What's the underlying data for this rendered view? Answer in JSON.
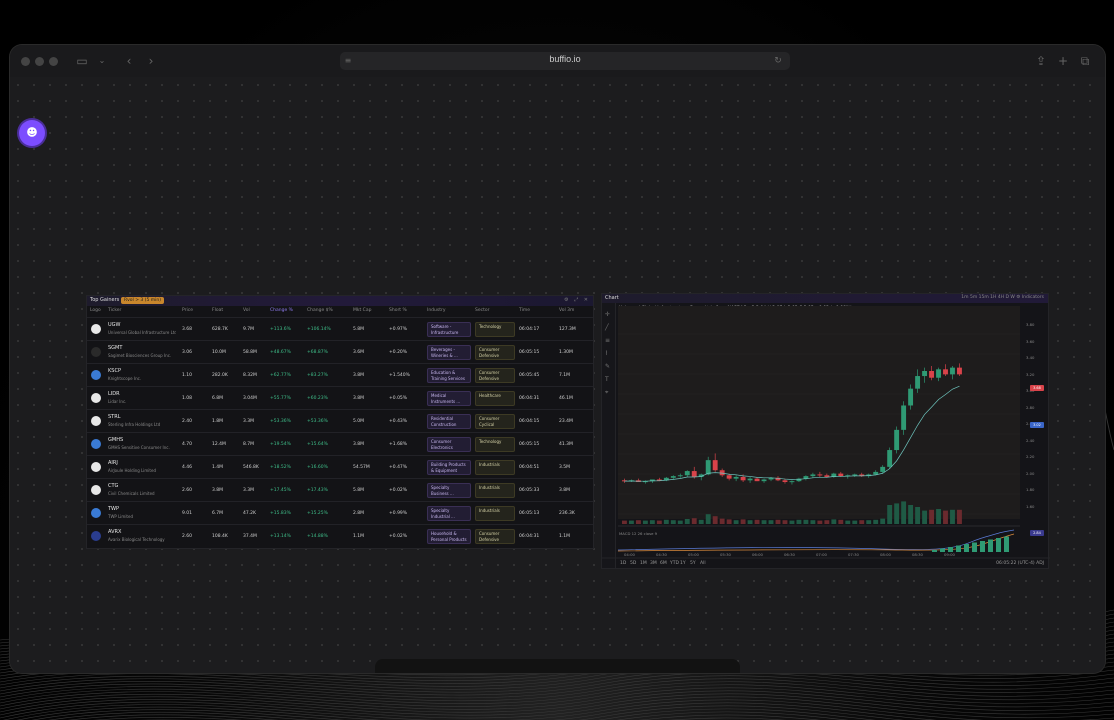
{
  "browser": {
    "url": "buffio.io",
    "nav": {
      "sidebar": "sidebar-icon",
      "back": "chevron-left-icon",
      "forward": "chevron-right-icon",
      "reload": "reload-icon",
      "share": "share-icon",
      "new_tab": "plus-icon",
      "tabs": "tabs-icon"
    }
  },
  "screener": {
    "title": "Top Gainers",
    "badge": "Rvol > 3 (5 min)",
    "columns": [
      "Logo",
      "Ticker",
      "Price",
      "Float",
      "Vol",
      "Change %",
      "Change $%",
      "Mkt Cap",
      "Short %",
      "Industry",
      "Sector",
      "Time",
      "Vol 3m"
    ],
    "rows": [
      {
        "sym": "UGW",
        "name": "Universal Global Infrastructure Ltd",
        "price": "3.68",
        "float": "628.7K",
        "vol": "9.7M",
        "chg": "+113.6%",
        "chg2": "+106.14%",
        "mcap": "5.8M",
        "short": "+0.97%",
        "industry": "Software - Infrastructure",
        "sector": "Technology",
        "time": "06:04:17",
        "vol3m": "127.3M",
        "logo": "#e8e8e8"
      },
      {
        "sym": "SGMT",
        "name": "Sagimet Biosciences Group Inc.",
        "price": "3.06",
        "float": "10.0M",
        "vol": "58.8M",
        "chg": "+48.67%",
        "chg2": "+68.87%",
        "mcap": "3.6M",
        "short": "+0.20%",
        "industry": "Beverages - Wineries & ...",
        "sector": "Consumer Defensive",
        "time": "06:05:15",
        "vol3m": "1.30M",
        "logo": "#2a2a2a"
      },
      {
        "sym": "KSCP",
        "name": "Knightscope Inc.",
        "price": "1.10",
        "float": "282.0K",
        "vol": "8.32M",
        "chg": "+62.77%",
        "chg2": "+83.27%",
        "mcap": "3.8M",
        "short": "+1.540%",
        "industry": "Education & Training Services",
        "sector": "Consumer Defensive",
        "time": "06:05:45",
        "vol3m": "7.1M",
        "logo": "#3a7bd5"
      },
      {
        "sym": "LIDR",
        "name": "Lidar Inc.",
        "price": "1.08",
        "float": "6.8M",
        "vol": "3.04M",
        "chg": "+55.77%",
        "chg2": "+60.23%",
        "mcap": "3.8M",
        "short": "+0.05%",
        "industry": "Medical Instruments ...",
        "sector": "Healthcare",
        "time": "06:04:31",
        "vol3m": "46.1M",
        "logo": "#e8e8e8"
      },
      {
        "sym": "STRL",
        "name": "Sterling Infra Holdings Ltd",
        "price": "2.40",
        "float": "1.8M",
        "vol": "3.3M",
        "chg": "+53.36%",
        "chg2": "+53.36%",
        "mcap": "5.0M",
        "short": "+0.43%",
        "industry": "Residential Construction",
        "sector": "Consumer Cyclical",
        "time": "06:04:15",
        "vol3m": "23.4M",
        "logo": "#e8e8e8"
      },
      {
        "sym": "GMHS",
        "name": "GMHS Sensitive Consumer Inc.",
        "price": "4.70",
        "float": "12.4M",
        "vol": "8.7M",
        "chg": "+19.54%",
        "chg2": "+15.64%",
        "mcap": "3.8M",
        "short": "+1.68%",
        "industry": "Consumer Electronics",
        "sector": "Technology",
        "time": "06:05:15",
        "vol3m": "41.3M",
        "logo": "#3a7bd5"
      },
      {
        "sym": "AIRJ",
        "name": "AirJoule Holding Limited",
        "price": "4.46",
        "float": "1.4M",
        "vol": "546.8K",
        "chg": "+18.52%",
        "chg2": "+16.60%",
        "mcap": "54.57M",
        "short": "+0.47%",
        "industry": "Building Products & Equipment",
        "sector": "Industrials",
        "time": "06:04:51",
        "vol3m": "3.5M",
        "logo": "#e8e8e8"
      },
      {
        "sym": "CTG",
        "name": "Civil Chemicals Limited",
        "price": "2.60",
        "float": "3.8M",
        "vol": "3.3M",
        "chg": "+17.45%",
        "chg2": "+17.43%",
        "mcap": "5.8M",
        "short": "+0.02%",
        "industry": "Specialty Business ...",
        "sector": "Industrials",
        "time": "06:05:33",
        "vol3m": "3.8M",
        "logo": "#e8e8e8"
      },
      {
        "sym": "TWP",
        "name": "TWP Limited",
        "price": "9.01",
        "float": "6.7M",
        "vol": "47.2K",
        "chg": "+15.83%",
        "chg2": "+15.25%",
        "mcap": "2.8M",
        "short": "+0.99%",
        "industry": "Specialty Industrial ...",
        "sector": "Industrials",
        "time": "06:05:13",
        "vol3m": "236.3K",
        "logo": "#3a7bd5"
      },
      {
        "sym": "AVRX",
        "name": "Avarix Biological Technology",
        "price": "2.60",
        "float": "108.4K",
        "vol": "37.4M",
        "chg": "+13.14%",
        "chg2": "+14.88%",
        "mcap": "1.1M",
        "short": "+0.02%",
        "industry": "Household & Personal Products",
        "sector": "Consumer Defensive",
        "time": "06:04:31",
        "vol3m": "1.1M",
        "logo": "#2a3d8f"
      }
    ]
  },
  "chart": {
    "title": "Chart",
    "symbol_line": "Universal Global Infrastructure Group Ltd · 1m · NASDAQ · O 2.04 H 2.07 L 2.02 C 2.05 +0.02 (+0.98%)",
    "indicators": [
      "Vol 9.635",
      "SMA 9 close 0",
      "EMA"
    ],
    "toolbar": "1m  5m  15m  1H  4H  D  W  ⚙  Indicators",
    "timeframes": [
      "1D",
      "5D",
      "1M",
      "3M",
      "6M",
      "YTD",
      "1Y",
      "5Y",
      "All"
    ],
    "footer_right": "06:05:22 (UTC-4)   ADJ",
    "macd_label": "MACD 12 26 close 9",
    "x_labels": [
      "04:00",
      "04:30",
      "05:00",
      "05:30",
      "06:00",
      "06:30",
      "07:00",
      "07:30",
      "08:00",
      "08:30",
      "09:00"
    ],
    "y_labels": [
      "3.80",
      "3.60",
      "3.40",
      "3.20",
      "3.00",
      "2.80",
      "2.60",
      "2.40",
      "2.20",
      "2.00",
      "1.80",
      "1.60"
    ],
    "price_tags": [
      "3.68",
      "3.02",
      "2.84"
    ],
    "chart_data": {
      "type": "candlestick",
      "ohlc": [
        [
          2.06,
          2.08,
          2.03,
          2.05
        ],
        [
          2.05,
          2.07,
          2.04,
          2.06
        ],
        [
          2.06,
          2.08,
          2.04,
          2.04
        ],
        [
          2.04,
          2.06,
          2.02,
          2.05
        ],
        [
          2.05,
          2.07,
          2.03,
          2.07
        ],
        [
          2.07,
          2.09,
          2.05,
          2.06
        ],
        [
          2.06,
          2.1,
          2.05,
          2.09
        ],
        [
          2.09,
          2.12,
          2.07,
          2.11
        ],
        [
          2.11,
          2.14,
          2.09,
          2.12
        ],
        [
          2.12,
          2.18,
          2.1,
          2.17
        ],
        [
          2.17,
          2.22,
          2.08,
          2.1
        ],
        [
          2.1,
          2.14,
          2.06,
          2.13
        ],
        [
          2.13,
          2.34,
          2.12,
          2.3
        ],
        [
          2.3,
          2.38,
          2.16,
          2.18
        ],
        [
          2.18,
          2.2,
          2.1,
          2.12
        ],
        [
          2.12,
          2.14,
          2.06,
          2.08
        ],
        [
          2.08,
          2.12,
          2.05,
          2.1
        ],
        [
          2.1,
          2.13,
          2.04,
          2.06
        ],
        [
          2.06,
          2.1,
          2.03,
          2.08
        ],
        [
          2.08,
          2.1,
          2.05,
          2.05
        ],
        [
          2.05,
          2.08,
          2.03,
          2.07
        ],
        [
          2.07,
          2.1,
          2.05,
          2.09
        ],
        [
          2.09,
          2.11,
          2.05,
          2.06
        ],
        [
          2.06,
          2.08,
          2.02,
          2.04
        ],
        [
          2.04,
          2.06,
          2.01,
          2.05
        ],
        [
          2.05,
          2.09,
          2.04,
          2.08
        ],
        [
          2.08,
          2.12,
          2.06,
          2.11
        ],
        [
          2.11,
          2.15,
          2.09,
          2.13
        ],
        [
          2.13,
          2.16,
          2.1,
          2.12
        ],
        [
          2.12,
          2.14,
          2.09,
          2.1
        ],
        [
          2.1,
          2.15,
          2.09,
          2.14
        ],
        [
          2.14,
          2.16,
          2.1,
          2.11
        ],
        [
          2.11,
          2.13,
          2.08,
          2.12
        ],
        [
          2.12,
          2.14,
          2.1,
          2.13
        ],
        [
          2.13,
          2.15,
          2.1,
          2.11
        ],
        [
          2.11,
          2.14,
          2.09,
          2.13
        ],
        [
          2.13,
          2.18,
          2.12,
          2.16
        ],
        [
          2.16,
          2.24,
          2.14,
          2.22
        ],
        [
          2.22,
          2.45,
          2.2,
          2.42
        ],
        [
          2.42,
          2.7,
          2.38,
          2.66
        ],
        [
          2.66,
          3.0,
          2.6,
          2.95
        ],
        [
          2.95,
          3.2,
          2.9,
          3.15
        ],
        [
          3.15,
          3.38,
          3.1,
          3.3
        ],
        [
          3.3,
          3.4,
          3.22,
          3.36
        ],
        [
          3.36,
          3.42,
          3.25,
          3.28
        ],
        [
          3.28,
          3.4,
          3.24,
          3.38
        ],
        [
          3.38,
          3.44,
          3.3,
          3.32
        ],
        [
          3.32,
          3.42,
          3.26,
          3.4
        ],
        [
          3.4,
          3.45,
          3.3,
          3.32
        ]
      ],
      "ylim": [
        1.6,
        3.8
      ]
    }
  }
}
